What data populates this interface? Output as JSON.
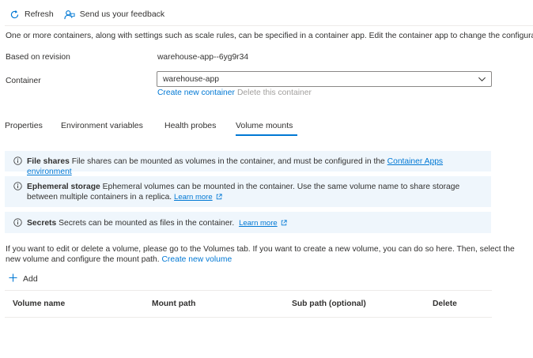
{
  "toolbar": {
    "refresh_label": "Refresh",
    "feedback_label": "Send us your feedback",
    "refresh_icon": "refresh-icon",
    "feedback_icon": "feedback-icon"
  },
  "description": "One or more containers, along with settings such as scale rules, can be specified in a container app. Edit the container app to change the configuration.",
  "revision": {
    "label": "Based on revision",
    "value": "warehouse-app--6yg9r34"
  },
  "container": {
    "label": "Container",
    "selected": "warehouse-app",
    "create_link": "Create new container",
    "delete_link": "Delete this container"
  },
  "tabs": [
    {
      "label": "Properties",
      "selected": false
    },
    {
      "label": "Environment variables",
      "selected": false
    },
    {
      "label": "Health probes",
      "selected": false
    },
    {
      "label": "Volume mounts",
      "selected": true
    }
  ],
  "info_boxes": {
    "file_shares": {
      "title": "File shares",
      "text": "File shares can be mounted as volumes in the container, and must be configured in the",
      "link": "Container Apps environment"
    },
    "ephemeral": {
      "title": "Ephemeral storage",
      "text": "Ephemeral volumes can be mounted in the container. Use the same volume name to share storage between multiple containers in a replica.",
      "link": "Learn more"
    },
    "secrets": {
      "title": "Secrets",
      "text": "Secrets can be mounted as files in the container.",
      "link": "Learn more"
    }
  },
  "volumes_text": "If you want to edit or delete a volume, please go to the Volumes tab. If you want to create a new volume, you can do so here. Then, select the new volume and configure the mount path.",
  "volumes_link": "Create new volume",
  "add_label": "Add",
  "table": {
    "columns": [
      "Volume name",
      "Mount path",
      "Sub path (optional)",
      "Delete"
    ]
  },
  "colors": {
    "accent": "#0078d4",
    "info_bg": "#eff6fc",
    "text": "#323130"
  }
}
